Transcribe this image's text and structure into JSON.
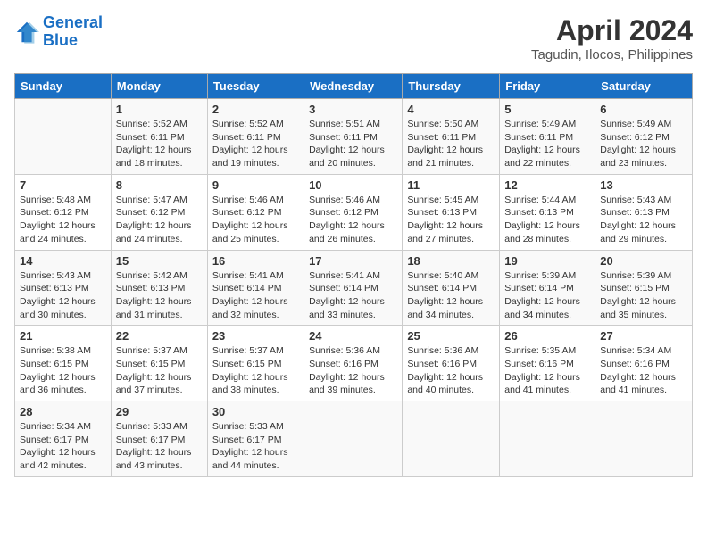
{
  "header": {
    "logo_line1": "General",
    "logo_line2": "Blue",
    "month_title": "April 2024",
    "location": "Tagudin, Ilocos, Philippines"
  },
  "weekdays": [
    "Sunday",
    "Monday",
    "Tuesday",
    "Wednesday",
    "Thursday",
    "Friday",
    "Saturday"
  ],
  "weeks": [
    [
      {
        "day": "",
        "info": ""
      },
      {
        "day": "1",
        "info": "Sunrise: 5:52 AM\nSunset: 6:11 PM\nDaylight: 12 hours\nand 18 minutes."
      },
      {
        "day": "2",
        "info": "Sunrise: 5:52 AM\nSunset: 6:11 PM\nDaylight: 12 hours\nand 19 minutes."
      },
      {
        "day": "3",
        "info": "Sunrise: 5:51 AM\nSunset: 6:11 PM\nDaylight: 12 hours\nand 20 minutes."
      },
      {
        "day": "4",
        "info": "Sunrise: 5:50 AM\nSunset: 6:11 PM\nDaylight: 12 hours\nand 21 minutes."
      },
      {
        "day": "5",
        "info": "Sunrise: 5:49 AM\nSunset: 6:11 PM\nDaylight: 12 hours\nand 22 minutes."
      },
      {
        "day": "6",
        "info": "Sunrise: 5:49 AM\nSunset: 6:12 PM\nDaylight: 12 hours\nand 23 minutes."
      }
    ],
    [
      {
        "day": "7",
        "info": "Sunrise: 5:48 AM\nSunset: 6:12 PM\nDaylight: 12 hours\nand 24 minutes."
      },
      {
        "day": "8",
        "info": "Sunrise: 5:47 AM\nSunset: 6:12 PM\nDaylight: 12 hours\nand 24 minutes."
      },
      {
        "day": "9",
        "info": "Sunrise: 5:46 AM\nSunset: 6:12 PM\nDaylight: 12 hours\nand 25 minutes."
      },
      {
        "day": "10",
        "info": "Sunrise: 5:46 AM\nSunset: 6:12 PM\nDaylight: 12 hours\nand 26 minutes."
      },
      {
        "day": "11",
        "info": "Sunrise: 5:45 AM\nSunset: 6:13 PM\nDaylight: 12 hours\nand 27 minutes."
      },
      {
        "day": "12",
        "info": "Sunrise: 5:44 AM\nSunset: 6:13 PM\nDaylight: 12 hours\nand 28 minutes."
      },
      {
        "day": "13",
        "info": "Sunrise: 5:43 AM\nSunset: 6:13 PM\nDaylight: 12 hours\nand 29 minutes."
      }
    ],
    [
      {
        "day": "14",
        "info": "Sunrise: 5:43 AM\nSunset: 6:13 PM\nDaylight: 12 hours\nand 30 minutes."
      },
      {
        "day": "15",
        "info": "Sunrise: 5:42 AM\nSunset: 6:13 PM\nDaylight: 12 hours\nand 31 minutes."
      },
      {
        "day": "16",
        "info": "Sunrise: 5:41 AM\nSunset: 6:14 PM\nDaylight: 12 hours\nand 32 minutes."
      },
      {
        "day": "17",
        "info": "Sunrise: 5:41 AM\nSunset: 6:14 PM\nDaylight: 12 hours\nand 33 minutes."
      },
      {
        "day": "18",
        "info": "Sunrise: 5:40 AM\nSunset: 6:14 PM\nDaylight: 12 hours\nand 34 minutes."
      },
      {
        "day": "19",
        "info": "Sunrise: 5:39 AM\nSunset: 6:14 PM\nDaylight: 12 hours\nand 34 minutes."
      },
      {
        "day": "20",
        "info": "Sunrise: 5:39 AM\nSunset: 6:15 PM\nDaylight: 12 hours\nand 35 minutes."
      }
    ],
    [
      {
        "day": "21",
        "info": "Sunrise: 5:38 AM\nSunset: 6:15 PM\nDaylight: 12 hours\nand 36 minutes."
      },
      {
        "day": "22",
        "info": "Sunrise: 5:37 AM\nSunset: 6:15 PM\nDaylight: 12 hours\nand 37 minutes."
      },
      {
        "day": "23",
        "info": "Sunrise: 5:37 AM\nSunset: 6:15 PM\nDaylight: 12 hours\nand 38 minutes."
      },
      {
        "day": "24",
        "info": "Sunrise: 5:36 AM\nSunset: 6:16 PM\nDaylight: 12 hours\nand 39 minutes."
      },
      {
        "day": "25",
        "info": "Sunrise: 5:36 AM\nSunset: 6:16 PM\nDaylight: 12 hours\nand 40 minutes."
      },
      {
        "day": "26",
        "info": "Sunrise: 5:35 AM\nSunset: 6:16 PM\nDaylight: 12 hours\nand 41 minutes."
      },
      {
        "day": "27",
        "info": "Sunrise: 5:34 AM\nSunset: 6:16 PM\nDaylight: 12 hours\nand 41 minutes."
      }
    ],
    [
      {
        "day": "28",
        "info": "Sunrise: 5:34 AM\nSunset: 6:17 PM\nDaylight: 12 hours\nand 42 minutes."
      },
      {
        "day": "29",
        "info": "Sunrise: 5:33 AM\nSunset: 6:17 PM\nDaylight: 12 hours\nand 43 minutes."
      },
      {
        "day": "30",
        "info": "Sunrise: 5:33 AM\nSunset: 6:17 PM\nDaylight: 12 hours\nand 44 minutes."
      },
      {
        "day": "",
        "info": ""
      },
      {
        "day": "",
        "info": ""
      },
      {
        "day": "",
        "info": ""
      },
      {
        "day": "",
        "info": ""
      }
    ]
  ]
}
